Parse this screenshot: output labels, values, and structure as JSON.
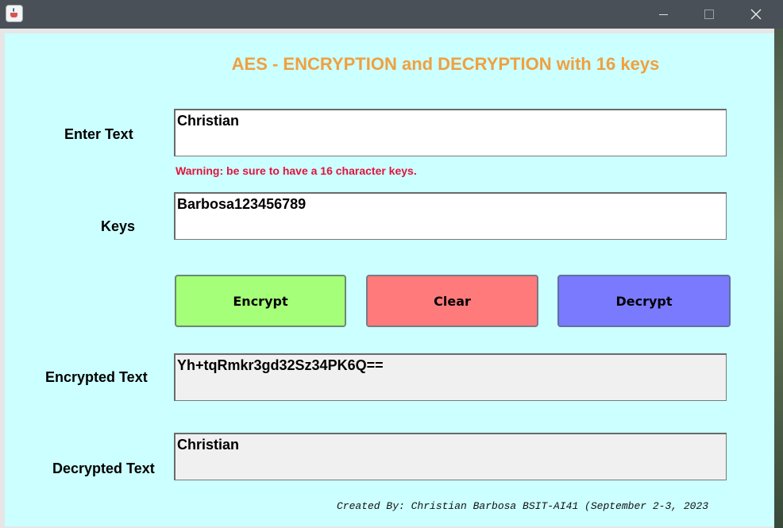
{
  "window": {
    "close_glyph": "✕",
    "minimize_glyph": "—",
    "maximize_glyph": "☐"
  },
  "header": {
    "title": "AES - ENCRYPTION and DECRYPTION with 16 keys",
    "title_color": "#f0a040"
  },
  "form": {
    "enter_text_label": "Enter Text",
    "enter_text_value": "Christian",
    "warning": "Warning: be sure to have a 16 character keys.",
    "warning_color": "#e0143c",
    "keys_label": "Keys",
    "keys_value": "Barbosa123456789",
    "encrypted_label": "Encrypted Text",
    "encrypted_value": "Yh+tqRmkr3gd32Sz34PK6Q==",
    "decrypted_label": "Decrypted Text",
    "decrypted_value": "Christian"
  },
  "buttons": {
    "encrypt": "Encrypt",
    "clear": "Clear",
    "decrypt": "Decrypt",
    "encrypt_color": "#a6ff78",
    "clear_color": "#ff7a7a",
    "decrypt_color": "#7a7aff"
  },
  "footer": {
    "credit": "Created By: Christian Barbosa BSIT-AI41 (September 2-3, 2023"
  },
  "colors": {
    "background": "#ccffff",
    "titlebar": "#4a5058"
  },
  "icons": {
    "app": "java-cup-icon",
    "minimize": "minimize-icon",
    "maximize": "maximize-icon",
    "close": "close-icon"
  }
}
